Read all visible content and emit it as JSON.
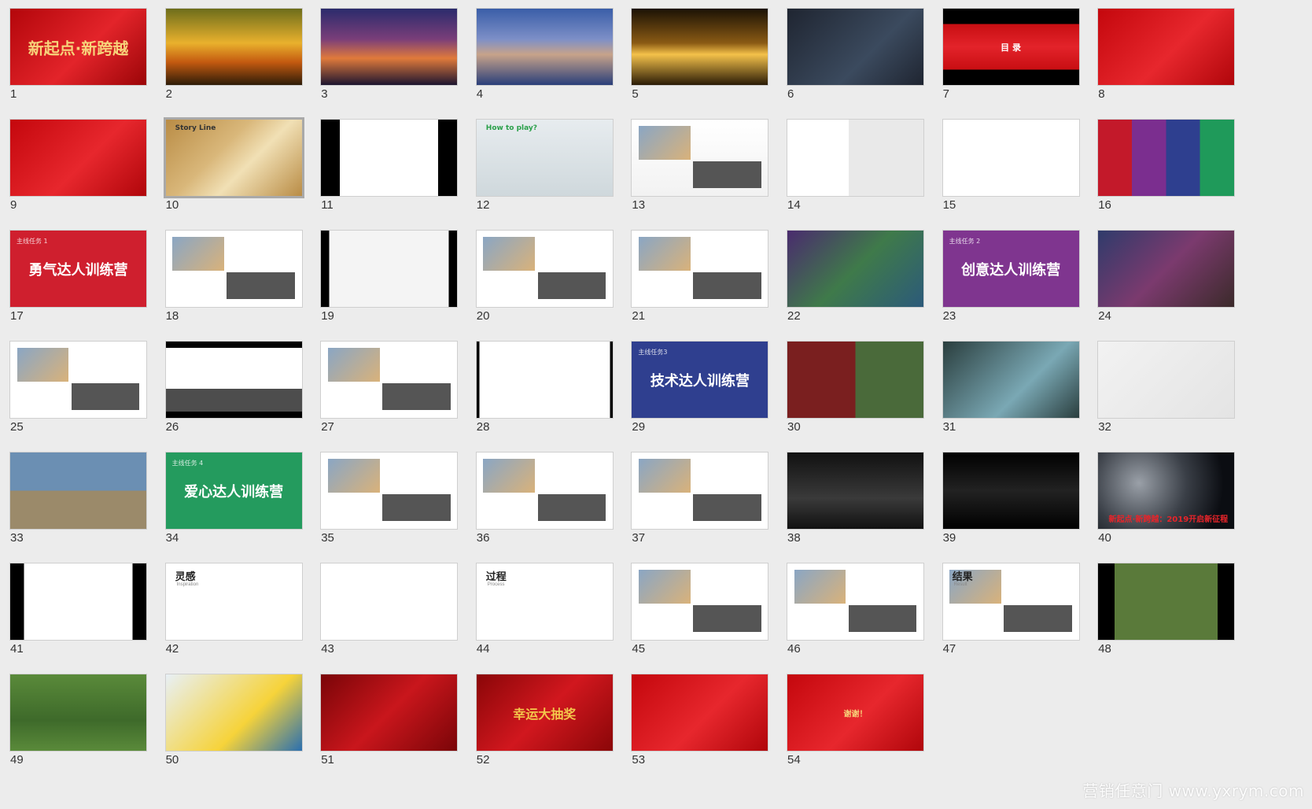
{
  "app": {
    "view": "slide-sorter",
    "selected_slide": 10,
    "watermark": "营销任意门 www.yxrym.com"
  },
  "slides": [
    {
      "number": "1",
      "bg": "linear-gradient(135deg,#b3060b,#e3242a 55%,#9b0508)",
      "title": "新起点·新跨越",
      "title_color": "#f7d27a",
      "title_size": 20
    },
    {
      "number": "2",
      "bg": "linear-gradient(180deg,#6d6d1b 0%,#e9b12d 45%,#c45a10 70%,#2e1c08 100%)"
    },
    {
      "number": "3",
      "bg": "linear-gradient(180deg,#2b2b6c 0%,#7a3e79 40%,#e07a3b 65%,#1d1530 100%)"
    },
    {
      "number": "4",
      "bg": "linear-gradient(180deg,#3a5ea8 0%,#7d8fc7 40%,#c7a38a 60%,#2a3e7a 100%)"
    },
    {
      "number": "5",
      "bg": "linear-gradient(180deg,#1b1205 0%,#8a5a14 45%,#f4c14a 60%,#2a1b06 100%)"
    },
    {
      "number": "6",
      "bg": "linear-gradient(135deg,#1f2531,#3b4a5e 60%,#1f2531)"
    },
    {
      "number": "7",
      "bg": "linear-gradient(180deg,#000 0%,#000 20%,#c80e12 20%,#e3232a 50%,#c80e12 80%,#000 80%)",
      "title": "目 录",
      "title_color": "#fff",
      "title_size": 11
    },
    {
      "number": "8",
      "bg": "linear-gradient(135deg,#c4070d,#e7272d 55%,#b0060b)"
    },
    {
      "number": "9",
      "bg": "linear-gradient(135deg,#c4070d,#e7272d 55%,#b0060b)"
    },
    {
      "number": "10",
      "bg": "linear-gradient(135deg,#b98c45,#d9b77a 40%,#f1e0b5 60%,#b98c45)",
      "title": "Story Line",
      "title_color": "#333",
      "title_size": 9,
      "title_top": true
    },
    {
      "number": "11",
      "bg": "linear-gradient(90deg,#000 14%,#fff 14%,#fff 86%,#000 86%)"
    },
    {
      "number": "12",
      "bg": "linear-gradient(180deg,#e7ecef,#cfd8dc)",
      "title": "How to play?",
      "title_color": "#2aa04a",
      "title_size": 9,
      "title_top": true
    },
    {
      "number": "13",
      "bg": "linear-gradient(180deg,#fff,#f2f2f2)"
    },
    {
      "number": "14",
      "bg": "linear-gradient(90deg,#fff 45%,#e9e9e9 45%)"
    },
    {
      "number": "15",
      "bg": "#ffffff"
    },
    {
      "number": "16",
      "bg": "linear-gradient(90deg,#c3192a 0 25%,#7b2e8f 25% 50%,#2e3f8f 50% 75%,#1f9a5a 75% 100%)"
    },
    {
      "number": "17",
      "bg": "#cf1f2e",
      "title": "勇气达人训练营",
      "title_color": "#fff",
      "title_size": 18,
      "tag": "主线任务 1"
    },
    {
      "number": "18",
      "bg": "#ffffff"
    },
    {
      "number": "19",
      "bg": "linear-gradient(90deg,#000 0 6%,#f4f4f4 6% 94%,#000 94%)"
    },
    {
      "number": "20",
      "bg": "#ffffff"
    },
    {
      "number": "21",
      "bg": "#ffffff"
    },
    {
      "number": "22",
      "bg": "linear-gradient(135deg,#4a2b6e,#3f7a4a 50%,#2c5a7a)"
    },
    {
      "number": "23",
      "bg": "#7f358f",
      "title": "创意达人训练营",
      "title_color": "#fff",
      "title_size": 18,
      "tag": "主线任务 2"
    },
    {
      "number": "24",
      "bg": "linear-gradient(135deg,#2f3b6b,#7b3a6e 50%,#3b2a2a)"
    },
    {
      "number": "25",
      "bg": "#ffffff"
    },
    {
      "number": "26",
      "bg": "linear-gradient(180deg,#000 0 8%,#fff 8% 62%,#4d4d4d 62% 92%,#000 92%)"
    },
    {
      "number": "27",
      "bg": "#ffffff"
    },
    {
      "number": "28",
      "bg": "linear-gradient(90deg,#000 0 2%,#fff 2% 98%,#000 98%)"
    },
    {
      "number": "29",
      "bg": "#2f3f8f",
      "title": "技术达人训练营",
      "title_color": "#fff",
      "title_size": 18,
      "tag": "主线任务3"
    },
    {
      "number": "30",
      "bg": "linear-gradient(90deg,#7a1f1f 0 50%,#4a6a3a 50%)"
    },
    {
      "number": "31",
      "bg": "linear-gradient(135deg,#2a3e3e,#7aa8b4 60%,#2a3e3e)"
    },
    {
      "number": "32",
      "bg": "linear-gradient(135deg,#f2f2f2,#e4e4e4)"
    },
    {
      "number": "33",
      "bg": "linear-gradient(180deg,#6b8fb3 0 50%,#9b8a6a 50%)"
    },
    {
      "number": "34",
      "bg": "#249b5e",
      "title": "爱心达人训练营",
      "title_color": "#fff",
      "title_size": 18,
      "tag": "主线任务 4"
    },
    {
      "number": "35",
      "bg": "#ffffff"
    },
    {
      "number": "36",
      "bg": "#ffffff"
    },
    {
      "number": "37",
      "bg": "#ffffff"
    },
    {
      "number": "38",
      "bg": "linear-gradient(180deg,#111,#3a3a3a 60%,#111)"
    },
    {
      "number": "39",
      "bg": "linear-gradient(180deg,#000,#222 50%,#000)"
    },
    {
      "number": "40",
      "bg": "radial-gradient(circle at 30% 40%,#9aa0a8,#3a3f47 45%,#0b0d12 80%)",
      "title": "新起点·新跨越：2019开启新征程",
      "title_color": "#e8242a",
      "title_size": 10,
      "title_bottom": true
    },
    {
      "number": "41",
      "bg": "linear-gradient(90deg,#000 0 10%,#fff 10% 90%,#000 90%)"
    },
    {
      "number": "42",
      "bg": "#ffffff",
      "title": "灵感",
      "title_color": "#222",
      "title_size": 13,
      "title_top": true,
      "subtitle": "Inspiration"
    },
    {
      "number": "43",
      "bg": "#ffffff"
    },
    {
      "number": "44",
      "bg": "#ffffff",
      "title": "过程",
      "title_color": "#222",
      "title_size": 13,
      "title_top": true,
      "subtitle": "Process"
    },
    {
      "number": "45",
      "bg": "#ffffff"
    },
    {
      "number": "46",
      "bg": "#ffffff"
    },
    {
      "number": "47",
      "bg": "#ffffff",
      "title": "结果",
      "title_color": "#222",
      "title_size": 13,
      "title_top": true,
      "subtitle": "Result"
    },
    {
      "number": "48",
      "bg": "linear-gradient(90deg,#000 0 12%,#5a7a3a 12% 88%,#000 88%)"
    },
    {
      "number": "49",
      "bg": "linear-gradient(180deg,#5a8a3a,#3e6a2a 60%,#5a8a3a)"
    },
    {
      "number": "50",
      "bg": "linear-gradient(135deg,#e8f0f6,#f6d33a 60%,#2a6fb0)"
    },
    {
      "number": "51",
      "bg": "linear-gradient(135deg,#7a0508,#c9161c 50%,#7a0508)"
    },
    {
      "number": "52",
      "bg": "linear-gradient(135deg,#8a0608,#d1171e 50%,#8a0608)",
      "title": "幸运大抽奖",
      "title_color": "#f3c64b",
      "title_size": 16
    },
    {
      "number": "53",
      "bg": "linear-gradient(135deg,#c4070d,#e7272d 55%,#b0060b)"
    },
    {
      "number": "54",
      "bg": "linear-gradient(135deg,#c4070d,#e7272d 55%,#b0060b)",
      "title": "谢谢！",
      "title_color": "#f7d27a",
      "title_size": 10
    }
  ]
}
